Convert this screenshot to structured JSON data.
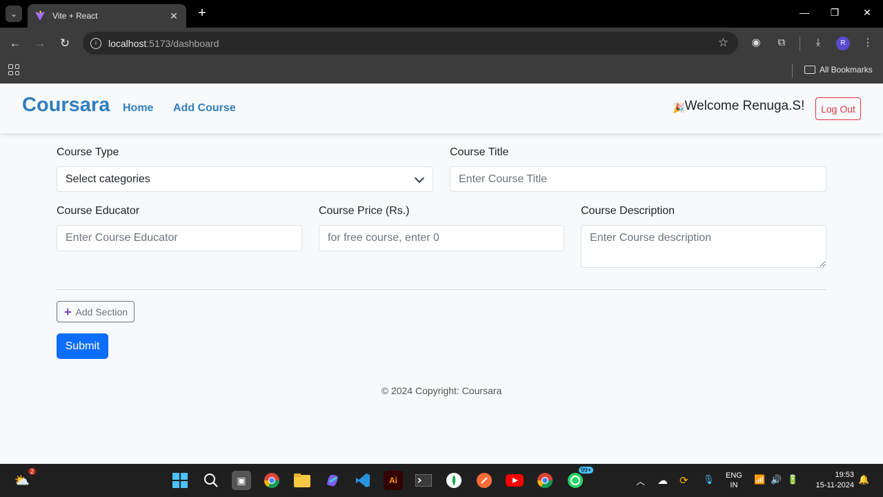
{
  "browser": {
    "tab_title": "Vite + React",
    "url_host": "localhost",
    "url_path": ":5173/dashboard",
    "bookmarks_label": "All Bookmarks",
    "profile_initial": "R"
  },
  "navbar": {
    "brand": "Coursara",
    "links": [
      "Home",
      "Add Course"
    ],
    "welcome": "Welcome Renuga.S!",
    "logout_label": "Log Out"
  },
  "form": {
    "course_type_label": "Course Type",
    "course_type_value": "Select categories",
    "course_title_label": "Course Title",
    "course_title_placeholder": "Enter Course Title",
    "educator_label": "Course Educator",
    "educator_placeholder": "Enter Course Educator",
    "price_label": "Course Price (Rs.)",
    "price_placeholder": "for free course, enter 0",
    "description_label": "Course Description",
    "description_placeholder": "Enter Course description",
    "add_section_label": "Add Section",
    "submit_label": "Submit"
  },
  "footer": {
    "text": "© 2024 Copyright: Coursara"
  },
  "taskbar": {
    "weather_badge": "2",
    "whatsapp_badge": "99+",
    "lang_line1": "ENG",
    "lang_line2": "IN",
    "time": "19:53",
    "date": "15-11-2024"
  },
  "colors": {
    "brand": "#2f7ebf",
    "primary": "#0d6efd",
    "danger": "#dc3545",
    "secondary": "#6c757d"
  }
}
